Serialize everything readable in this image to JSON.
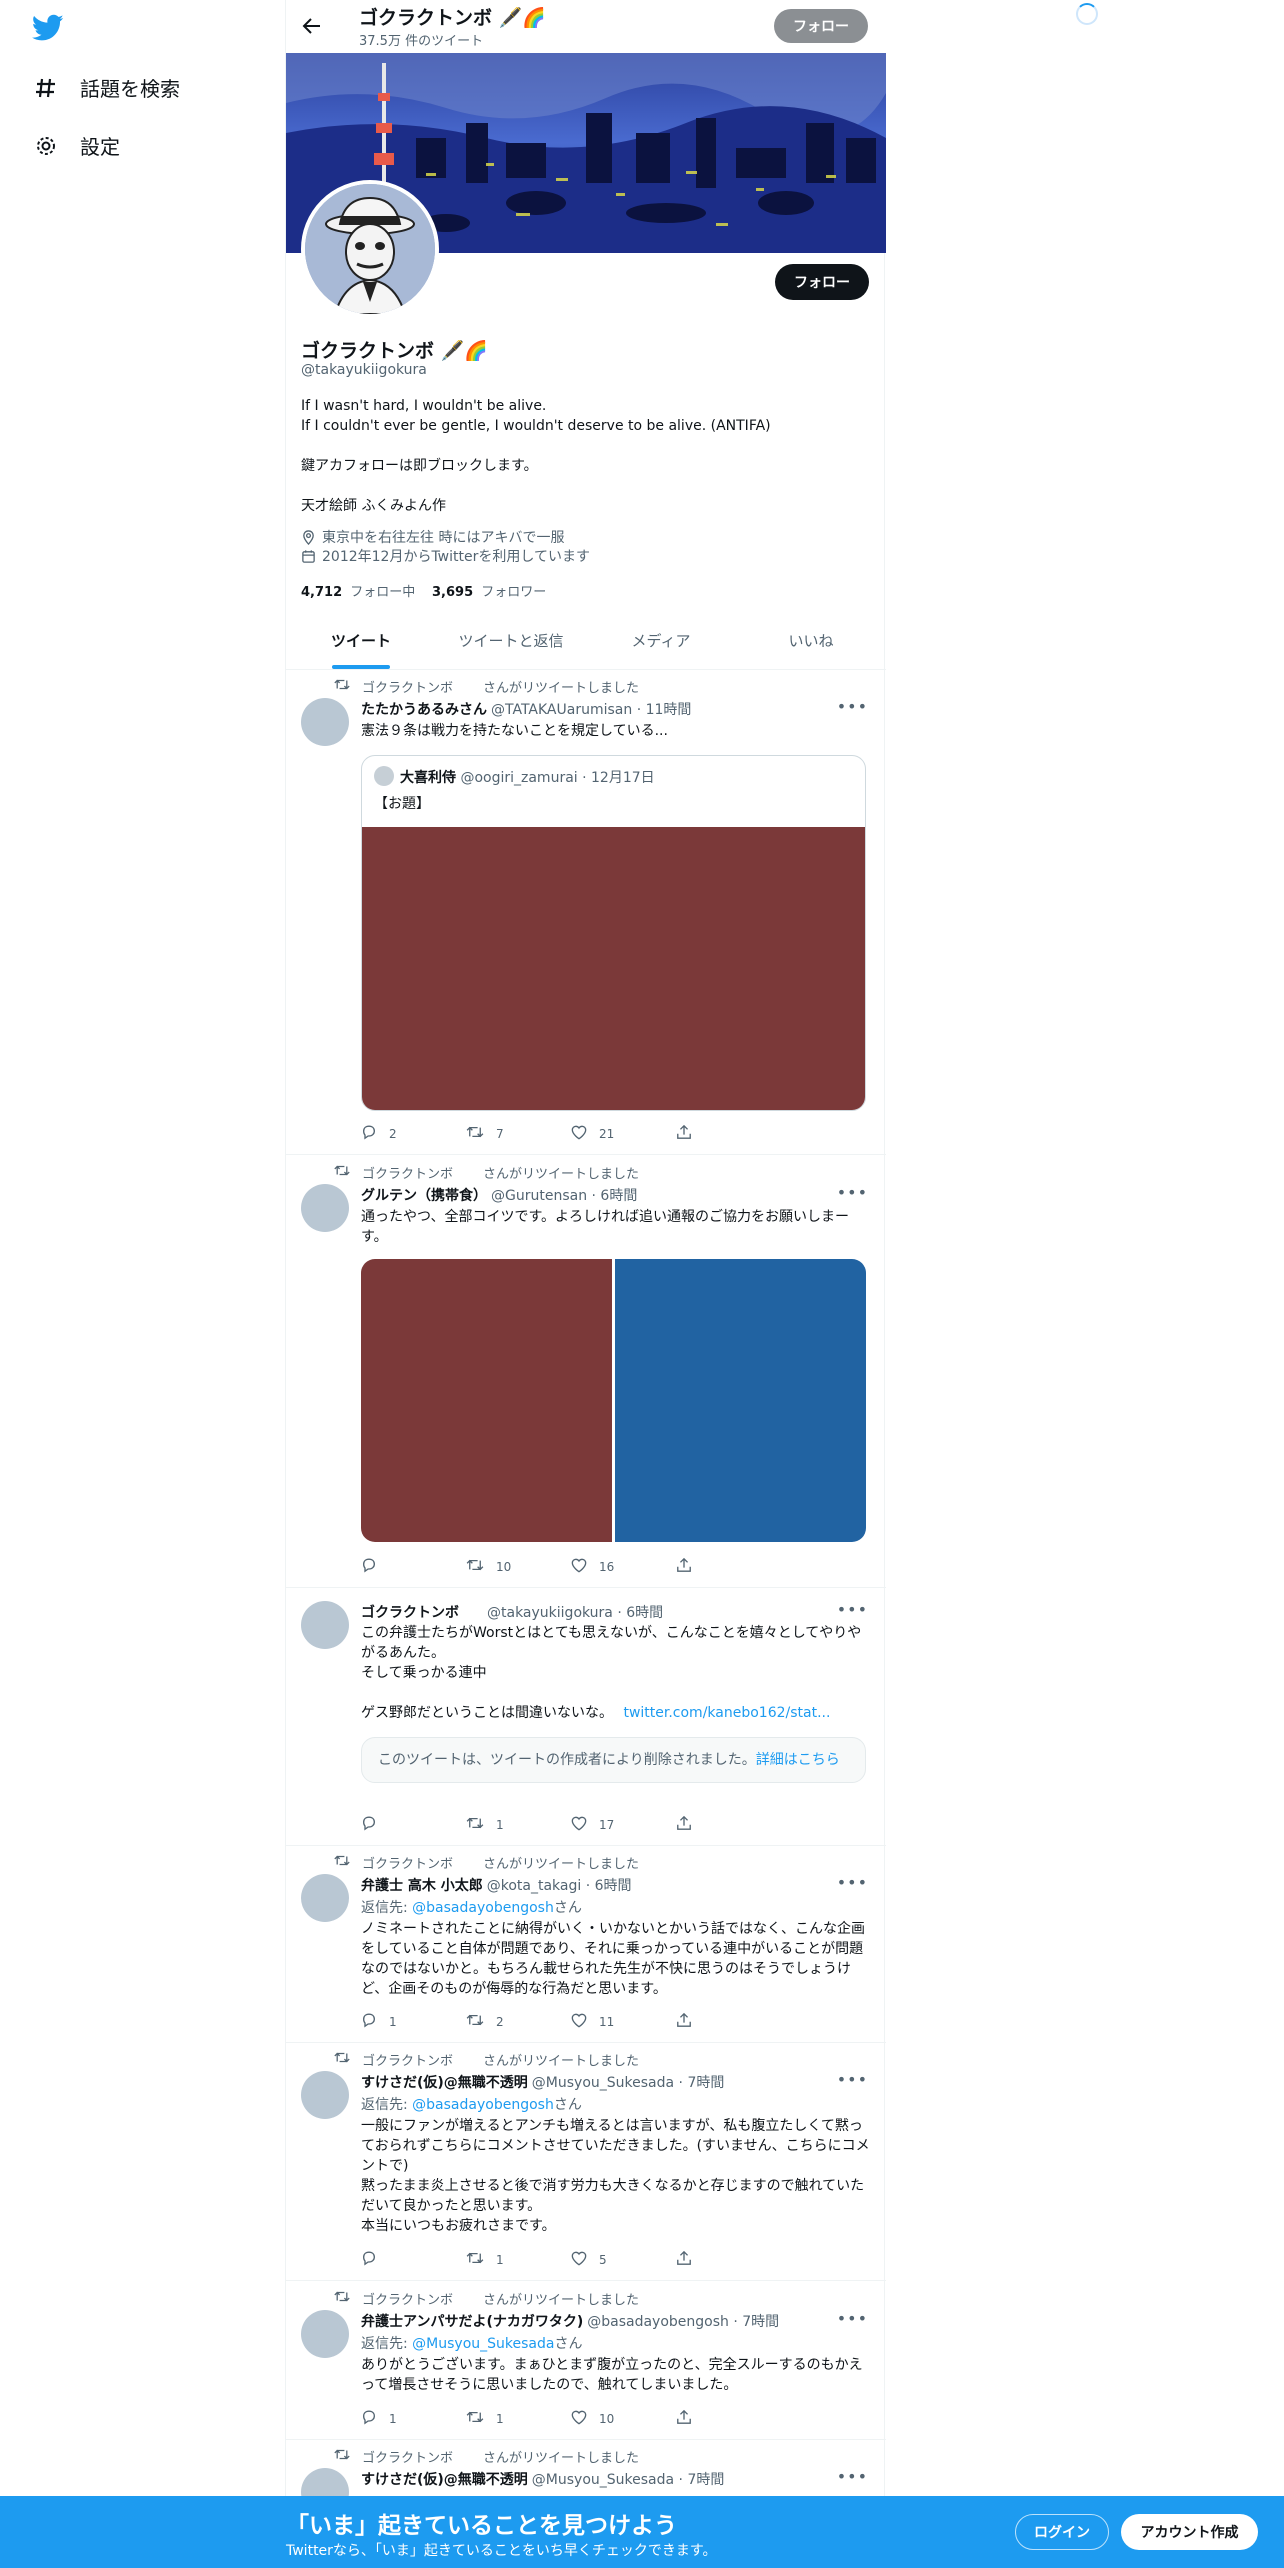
{
  "sidebar": {
    "explore_label": "話題を検索",
    "settings_label": "設定"
  },
  "header": {
    "name": "ゴクラクトンボ 🖋️🌈",
    "tweet_count": "37.5万 件のツイート",
    "follow_label": "フォロー"
  },
  "profile": {
    "name": "ゴクラクトンボ 🖋️🌈",
    "handle": "@takayukiigokura",
    "follow_label": "フォロー",
    "bio": [
      "If I wasn't hard, I wouldn't be alive.",
      "If I couldn't ever be gentle, I wouldn't deserve to be alive. (ANTIFA)",
      "",
      "鍵アカフォローは即ブロックします。",
      "",
      "天才絵師 ふくみよん作"
    ],
    "location": "東京中を右往左往 時にはアキバで一服",
    "joined": "2012年12月からTwitterを利用しています",
    "following_count": "4,712",
    "following_label": "フォロー中",
    "followers_count": "3,695",
    "followers_label": "フォロワー"
  },
  "tabs": [
    "ツイート",
    "ツイートと返信",
    "メディア",
    "いいね"
  ],
  "retweet_label": {
    "who": "ゴクラクトンボ",
    "suffix": "さんがリツイートしました"
  },
  "tweets": [
    {
      "name": "たたかうあるみさん",
      "handle": "@TATAKAUarumisan · 11時間",
      "text": "憲法９条は戦力を持たないことを規定している...",
      "quote": {
        "name": "大喜利侍",
        "handle": "@oogiri_zamurai · 12月17日",
        "text": "【お題】"
      },
      "replies": "2",
      "retweets": "7",
      "likes": "21"
    },
    {
      "name": "グルテン（携帯食）",
      "handle": "@Gurutensan · 6時間",
      "text": "通ったやつ、全部コイツです。よろしければ追い通報のご協力をお願いしまーす。",
      "replies": "",
      "retweets": "10",
      "likes": "16"
    },
    {
      "name": "ゴクラクトンボ",
      "handle": "@takayukiigokura · 6時間",
      "text_lines": [
        "この弁護士たちがWorstとはとても思えないが、こんなことを嬉々としてやりやがるあんた。",
        "そして乗っかる連中",
        "",
        "ゲス野郎だということは間違いないな。"
      ],
      "link": "twitter.com/kanebo162/stat...",
      "deleted_notice": "このツイートは、ツイートの作成者により削除されました。",
      "deleted_link": "詳細はこちら",
      "replies": "",
      "retweets": "1",
      "likes": "17"
    },
    {
      "name": "弁護士 高木 小太郎",
      "handle": "@kota_takagi · 6時間",
      "reply_prefix": "返信先: ",
      "reply_to": "@basadayobengosh",
      "reply_suffix": "さん",
      "text": "ノミネートされたことに納得がいく・いかないとかいう話ではなく、こんな企画をしていること自体が問題であり、それに乗っかっている連中がいることが問題なのではないかと。もちろん載せられた先生が不快に思うのはそうでしょうけど、企画そのものが侮辱的な行為だと思います。",
      "replies": "1",
      "retweets": "2",
      "likes": "11"
    },
    {
      "name": "すけさだ(仮)@無職不透明",
      "handle": "@Musyou_Sukesada · 7時間",
      "reply_prefix": "返信先: ",
      "reply_to": "@basadayobengosh",
      "reply_suffix": "さん",
      "text_lines": [
        "一般にファンが増えるとアンチも増えるとは言いますが、私も腹立たしくて黙っておられずこちらにコメントさせていただきました。(すいません、こちらにコメントで)",
        "黙ったまま炎上させると後で消す労力も大きくなるかと存じますので触れていただいて良かったと思います。",
        "本当にいつもお疲れさまです。"
      ],
      "replies": "",
      "retweets": "1",
      "likes": "5"
    },
    {
      "name": "弁護士アンパサだよ(ナカガワタク)",
      "handle": "@basadayobengosh · 7時間",
      "reply_prefix": "返信先: ",
      "reply_to": "@Musyou_Sukesada",
      "reply_suffix": "さん",
      "text": "ありがとうございます。まぁひとまず腹が立ったのと、完全スルーするのもかえって増長させそうに思いましたので、触れてしまいました。",
      "replies": "1",
      "retweets": "1",
      "likes": "10"
    },
    {
      "name": "すけさだ(仮)@無職不透明",
      "handle": "@Musyou_Sukesada · 7時間"
    }
  ],
  "bottom_bar": {
    "title": "「いま」起きていることを見つけよう",
    "subtitle": "Twitterなら、「いま」起きていることをいち早くチェックできます。",
    "login_label": "ログイン",
    "signup_label": "アカウント作成"
  },
  "colors": {
    "accent": "#1d9bf0",
    "media_red": "#7b3939",
    "media_blue": "#2163a2"
  }
}
